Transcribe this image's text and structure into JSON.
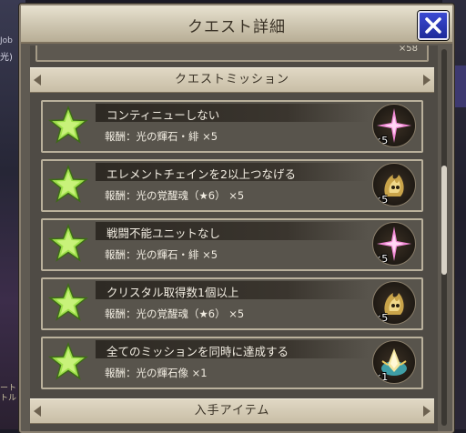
{
  "background": {
    "left_text_1": "Job",
    "left_text_2": "光)",
    "left_text_3": "ート\nトル"
  },
  "dialog": {
    "title": "クエスト詳細",
    "close_label": "✕"
  },
  "previous_card": {
    "count": "×58"
  },
  "sections": {
    "mission_title": "クエストミッション",
    "items_title": "入手アイテム"
  },
  "missions": [
    {
      "title": "コンティニューしない",
      "reward": "報酬：光の輝石・緋 ×5",
      "reward_icon": "pink-crystal-icon",
      "qty": "×5"
    },
    {
      "title": "エレメントチェインを2以上つなげる",
      "reward": "報酬：光の覚醒魂（★6） ×5",
      "reward_icon": "gold-soul-icon",
      "qty": "×5"
    },
    {
      "title": "戦闘不能ユニットなし",
      "reward": "報酬：光の輝石・緋 ×5",
      "reward_icon": "pink-crystal-icon",
      "qty": "×5"
    },
    {
      "title": "クリスタル取得数1個以上",
      "reward": "報酬：光の覚醒魂（★6） ×5",
      "reward_icon": "gold-soul-icon",
      "qty": "×5"
    },
    {
      "title": "全てのミッションを同時に達成する",
      "reward": "報酬：光の輝石像 ×1",
      "reward_icon": "crystal-statue-icon",
      "qty": "×1"
    }
  ],
  "colors": {
    "star_green": "#9ee04a",
    "close_blue": "#2836b8",
    "frame_gold": "#bab19c"
  }
}
